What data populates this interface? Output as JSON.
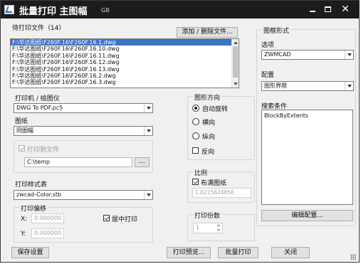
{
  "window": {
    "title": "批量打印 主图幅",
    "title_suffix": "GB",
    "controls": {
      "minimize": "_",
      "maximize": "□",
      "close": "✕"
    }
  },
  "pending": {
    "label": "待打印文件（14）",
    "add_remove_button": "添加 / 删除文件...",
    "files": [
      "F:\\华达图纸\\F260F.16\\F260F.16.1.dwg",
      "F:\\华达图纸\\F260F.16\\F260F.16.10.dwg",
      "F:\\华达图纸\\F260F.16\\F260F.16.11.dwg",
      "F:\\华达图纸\\F260F.16\\F260F.16.12.dwg",
      "F:\\华达图纸\\F260F.16\\F260F.16.13.dwg",
      "F:\\华达图纸\\F260F.16\\F260F.16.2.dwg",
      "F:\\华达图纸\\F260F.16\\F260F.16.3.dwg"
    ],
    "selected_index": 0
  },
  "printer": {
    "label": "打印机 / 绘图仪",
    "value": "DWG To PDF.pc5",
    "paper_label": "图纸",
    "paper_value": "同图幅",
    "print_to_file_label": "打印到文件",
    "print_to_file_checked": true,
    "path_value": "C:\\temp",
    "browse_button": "..."
  },
  "style_table": {
    "label": "打印样式表",
    "value": "zwcad-Color.stb"
  },
  "offset": {
    "label": "打印偏移",
    "x_label": "X:",
    "x_value": "0.000000",
    "y_label": "Y:",
    "y_value": "0.000000",
    "center_label": "居中打印",
    "center_checked": true
  },
  "orientation": {
    "label": "图形方向",
    "options": [
      "自动旋转",
      "横向",
      "纵向"
    ],
    "selected_index": 0,
    "reverse_label": "反向",
    "reverse_checked": false
  },
  "scale": {
    "label": "比例",
    "fit_label": "布满图纸",
    "fit_checked": true,
    "value": "1.0215624856"
  },
  "copies": {
    "label": "打印份数",
    "value": "1"
  },
  "frame": {
    "label": "图框形式",
    "option_label": "选项",
    "option_value": "ZWMCAD",
    "config_label": "配置",
    "config_value": "图形界限",
    "search_label": "搜索条件",
    "search_value": "BlockByExtents",
    "edit_config_button": "编辑配置..."
  },
  "footer": {
    "save_button": "保存设置",
    "preview_button": "打印预览...",
    "batch_print_button": "批量打印",
    "close_button": "关闭"
  },
  "colors": {
    "titlebar": "#1c1c1c",
    "selection": "#3b73c8",
    "option_selected": "#3b73c8"
  }
}
